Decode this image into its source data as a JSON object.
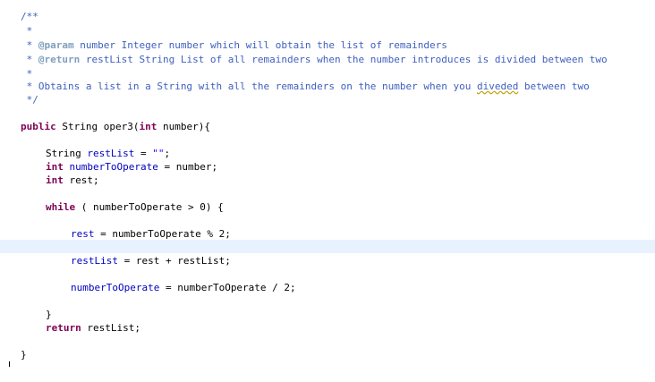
{
  "code": {
    "doc": {
      "open": "/**",
      "star": " *",
      "param_tag": "@param",
      "param_text": " number Integer number which will obtain the list of remainders",
      "return_tag": "@return",
      "return_text": " restList String List of all remainders when the number introduces is divided between two",
      "desc_before": " Obtains a list in a String with all the remainders on the number when you ",
      "desc_typo": "diveded",
      "desc_after": " between two",
      "close": " */"
    },
    "kw_public": "public",
    "method_sig_mid": " String oper3(",
    "kw_int": "int",
    "param_name": " number){",
    "l_string": "String ",
    "restList": "restList",
    "assign": " = ",
    "empty_str": "\"\"",
    "semicolon": ";",
    "numberToOperate": "numberToOperate",
    "number_var": "number;",
    "rest_decl": " rest;",
    "kw_while": "while",
    "while_open": " ( ",
    "while_cond": "numberToOperate > 0) {",
    "rest": "rest",
    "mod_expr": " = numberToOperate % 2;",
    "rest_plus": " = rest + restList;",
    "div_expr": " = numberToOperate / 2;",
    "close_brace": "}",
    "kw_return": "return",
    "return_expr": " restList;"
  }
}
